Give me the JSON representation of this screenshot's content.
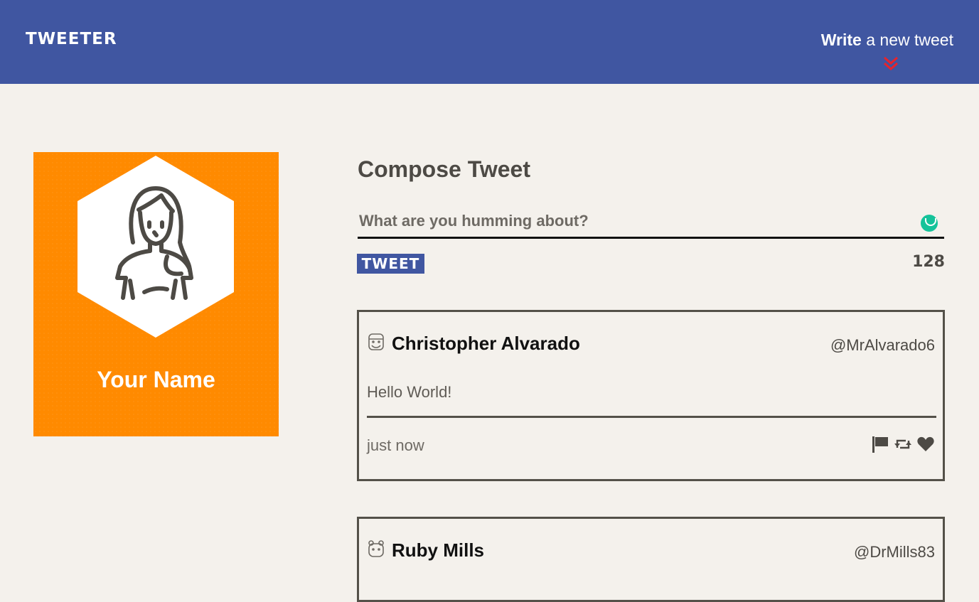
{
  "nav": {
    "brand": "TWEETER",
    "write_bold": "Write",
    "write_rest": "a new tweet",
    "chevron_icon": "double-chevron-down-icon",
    "bg_color": "#4056a1",
    "chevron_color": "#e8232b"
  },
  "profile": {
    "name": "Your Name",
    "avatar_icon": "woman-avatar-icon",
    "bg_color": "#ff8a00"
  },
  "compose": {
    "title": "Compose Tweet",
    "placeholder": "What are you humming about?",
    "button_label": "TWEET",
    "counter": "128",
    "grammar_icon": "grammarly-icon"
  },
  "tweets": [
    {
      "name": "Christopher Alvarado",
      "handle": "@MrAlvarado6",
      "text": "Hello World!",
      "time": "just now",
      "avatar_icon": "user-avatar-icon",
      "actions": [
        "flag-icon",
        "retweet-icon",
        "heart-icon"
      ]
    },
    {
      "name": "Ruby Mills",
      "handle": "@DrMills83",
      "avatar_icon": "user-avatar-icon"
    }
  ]
}
